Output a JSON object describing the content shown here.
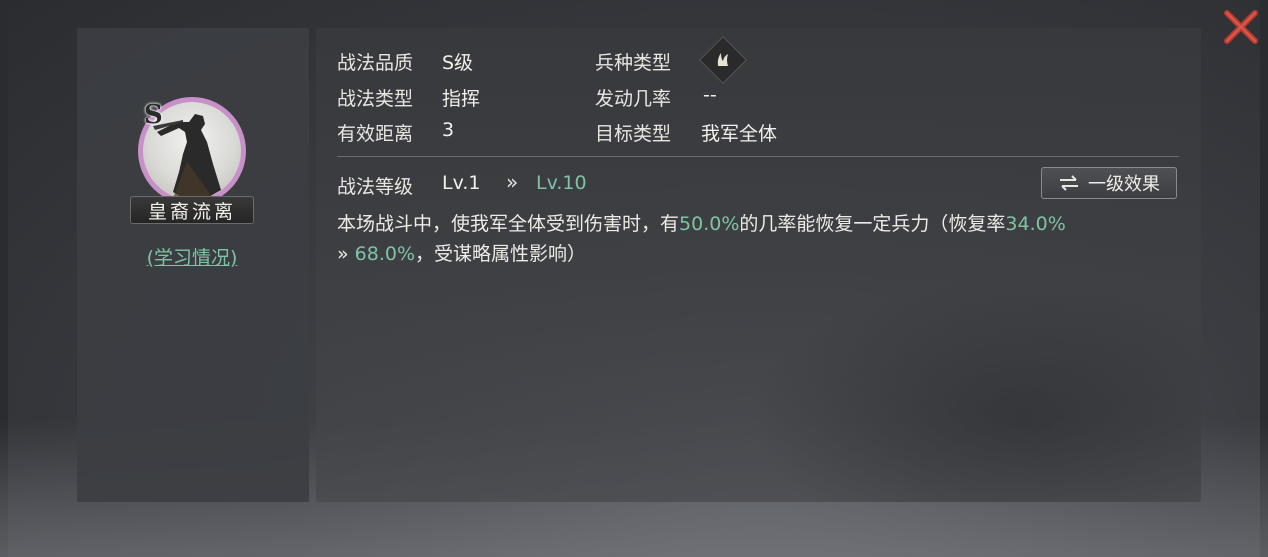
{
  "hero": {
    "quality": "S",
    "name": "皇裔流离",
    "study_link": "(学习情况)"
  },
  "tactic_info": {
    "quality_label": "战法品质",
    "quality_value": "S级",
    "type_label": "战法类型",
    "type_value": "指挥",
    "range_label": "有效距离",
    "range_value": "3",
    "unit_label": "兵种类型",
    "unit_icon": "unit-type-icon",
    "trigger_label": "发动几率",
    "trigger_value": "--",
    "target_label": "目标类型",
    "target_value": "我军全体"
  },
  "level": {
    "label": "战法等级",
    "current": "Lv.1",
    "arrow": "»",
    "max": "Lv.10",
    "effect_button": "一级效果"
  },
  "description": {
    "p1": "本场战斗中，使我军全体受到伤害时，有",
    "v1": "50.0%",
    "p2": "的几率能恢复一定兵力（恢复率",
    "v2": "34.0%",
    "arrow": "»",
    "v3": "68.0%",
    "p3": "，受谋略属性影响）"
  },
  "colors": {
    "highlight": "#7ec4a3",
    "portrait_ring": "#c890c8",
    "close": "#c0392b"
  }
}
